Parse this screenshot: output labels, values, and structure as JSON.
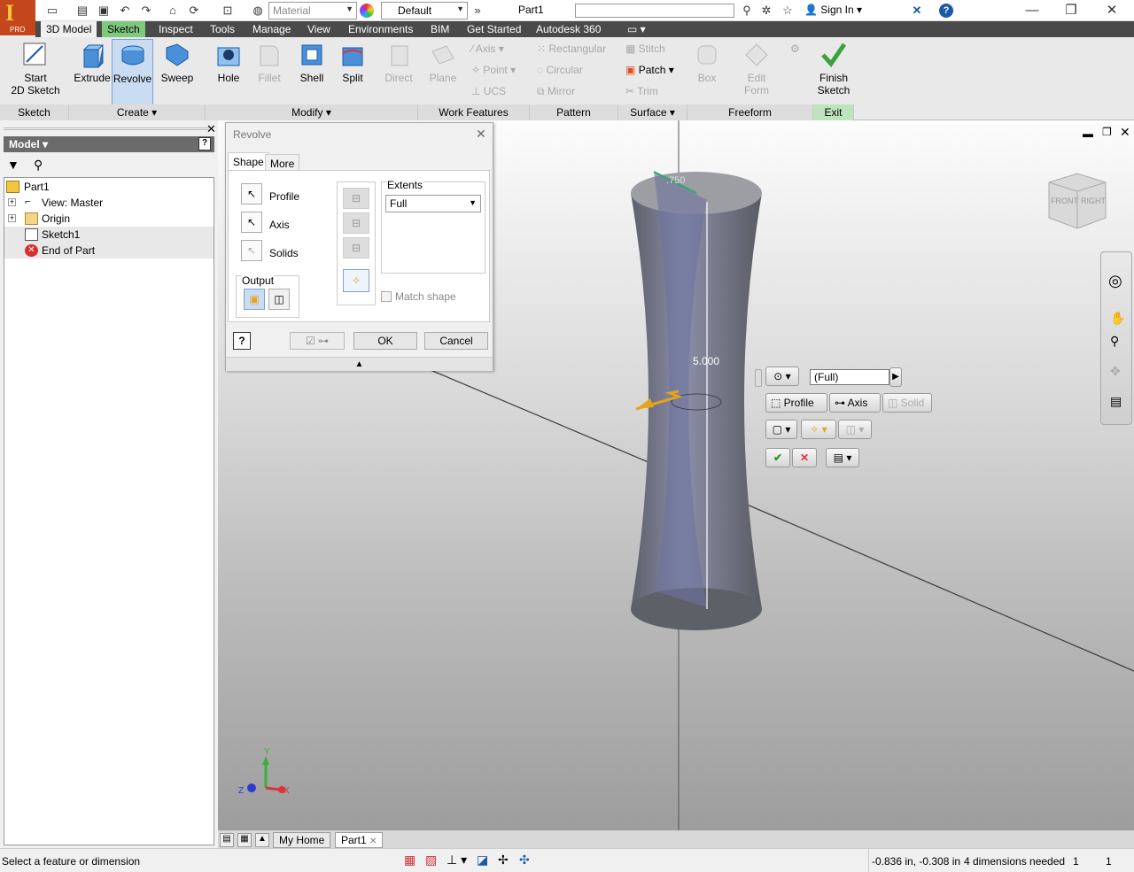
{
  "app": {
    "logo_letter": "I",
    "edition": "PRO",
    "doc_title": "Part1",
    "signin_label": "Sign In"
  },
  "qat": {
    "material_value": "Material",
    "appearance_value": "Default"
  },
  "menu_tabs": [
    "3D Model",
    "Sketch",
    "Inspect",
    "Tools",
    "Manage",
    "View",
    "Environments",
    "BIM",
    "Get Started",
    "Autodesk 360"
  ],
  "ribbon": {
    "sketch": {
      "start_line1": "Start",
      "start_line2": "2D Sketch"
    },
    "create": {
      "extrude": "Extrude",
      "revolve": "Revolve",
      "sweep": "Sweep"
    },
    "modify": {
      "hole": "Hole",
      "fillet": "Fillet",
      "shell": "Shell",
      "split": "Split",
      "direct": "Direct"
    },
    "work": {
      "plane": "Plane",
      "axis": "Axis",
      "point": "Point",
      "ucs": "UCS"
    },
    "pattern": {
      "rect": "Rectangular",
      "circ": "Circular",
      "mirror": "Mirror"
    },
    "surface": {
      "stitch": "Stitch",
      "patch": "Patch",
      "trim": "Trim"
    },
    "freeform": {
      "box": "Box",
      "edit_line1": "Edit",
      "edit_line2": "Form"
    },
    "exit": {
      "finish_line1": "Finish",
      "finish_line2": "Sketch"
    },
    "panels": [
      "Sketch",
      "Create ▾",
      "Modify ▾",
      "Work Features",
      "Pattern",
      "Surface ▾",
      "Freeform",
      "Exit"
    ]
  },
  "browser": {
    "title": "Model ▾",
    "nodes": [
      "Part1",
      "View: Master",
      "Origin",
      "Sketch1",
      "End of Part"
    ]
  },
  "dialog": {
    "title": "Revolve",
    "tab_shape": "Shape",
    "tab_more": "More",
    "profile": "Profile",
    "axis": "Axis",
    "solids": "Solids",
    "output": "Output",
    "extents_label": "Extents",
    "extents_value": "Full",
    "match_shape": "Match shape",
    "ok": "OK",
    "cancel": "Cancel"
  },
  "viewport": {
    "dim_top": ".750",
    "dim_height": "5.000",
    "viewcube_front": "FRONT",
    "viewcube_right": "RIGHT",
    "axis_y": "Y",
    "axis_z": "Z",
    "axis_x": "X"
  },
  "minitool": {
    "extent_value": "(Full)",
    "profile": "Profile",
    "axis": "Axis",
    "solid": "Solid"
  },
  "doctabs": {
    "home": "My Home",
    "part": "Part1"
  },
  "status": {
    "message": "Select a feature or dimension",
    "coords": "-0.836 in, -0.308 in",
    "dims_needed": "4 dimensions needed",
    "num1": "1",
    "num2": "1"
  },
  "colors": {
    "menubar": "#4a4a4a",
    "ribbon_sel": "#c9dcf1",
    "exit_green": "#3aa33a",
    "accent_orange": "#e8a21c"
  }
}
